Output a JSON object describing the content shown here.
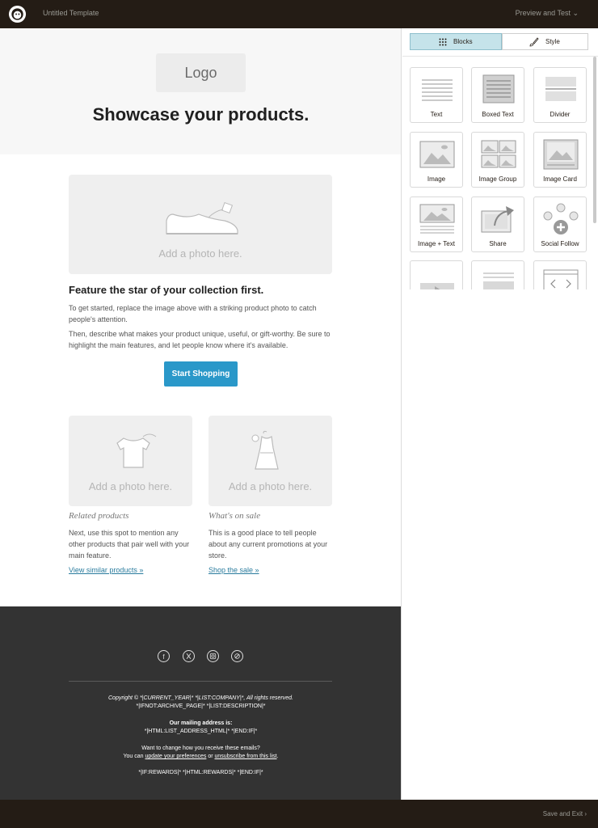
{
  "topbar": {
    "title": "Untitled Template",
    "preview": "Preview and Test ⌄"
  },
  "email": {
    "logo_placeholder": "Logo",
    "headline": "Showcase your products.",
    "main_photo_caption": "Add a photo here.",
    "feature_heading": "Feature the star of your collection first.",
    "feature_p1": "To get started, replace the image above with a striking product photo to catch people's attention.",
    "feature_p2": "Then, describe what makes your product unique, useful, or gift-worthy. Be sure to highlight the main features, and let people know where it's available.",
    "cta_button": "Start Shopping",
    "left_col": {
      "photo_caption": "Add a photo here.",
      "subhead": "Related products",
      "text": "Next, use this spot to mention any other products that pair well with your main feature.",
      "link": "View similar products »"
    },
    "right_col": {
      "photo_caption": "Add a photo here.",
      "subhead": "What's on sale",
      "text": "This is a good place to tell people about any current promotions at your store.",
      "link": "Shop the sale »"
    }
  },
  "footer": {
    "social_icons": [
      "facebook-icon",
      "x-icon",
      "instagram-icon",
      "website-icon"
    ],
    "copyright": "Copyright © *|CURRENT_YEAR|* *|LIST:COMPANY|*, All rights reserved.",
    "archive": "*|IFNOT:ARCHIVE_PAGE|* *|LIST:DESCRIPTION|*",
    "mailing_heading": "Our mailing address is:",
    "mailing_address": "*|HTML:LIST_ADDRESS_HTML|* *|END:IF|*",
    "change_q": "Want to change how you receive these emails?",
    "you_can": "You can ",
    "update_prefs": "update your preferences",
    "or": " or ",
    "unsubscribe": "unsubscribe from this list",
    "period": ".",
    "rewards": "*|IF:REWARDS|* *|HTML:REWARDS|* *|END:IF|*"
  },
  "panel": {
    "tabs": [
      {
        "label": "Blocks",
        "icon": "grid-icon",
        "active": true
      },
      {
        "label": "Style",
        "icon": "brush-icon",
        "active": false
      }
    ],
    "blocks": [
      {
        "label": "Text"
      },
      {
        "label": "Boxed Text"
      },
      {
        "label": "Divider"
      },
      {
        "label": "Image"
      },
      {
        "label": "Image Group"
      },
      {
        "label": "Image Card"
      },
      {
        "label": "Image + Text"
      },
      {
        "label": "Share"
      },
      {
        "label": "Social Follow"
      }
    ]
  },
  "bottombar": {
    "save_exit": "Save and Exit ›"
  },
  "colors": {
    "topbar": "#241c15",
    "accent_button": "#2a98c9",
    "active_tab": "#c5e3ea",
    "footer": "#333333",
    "link": "#2a7c9e"
  }
}
